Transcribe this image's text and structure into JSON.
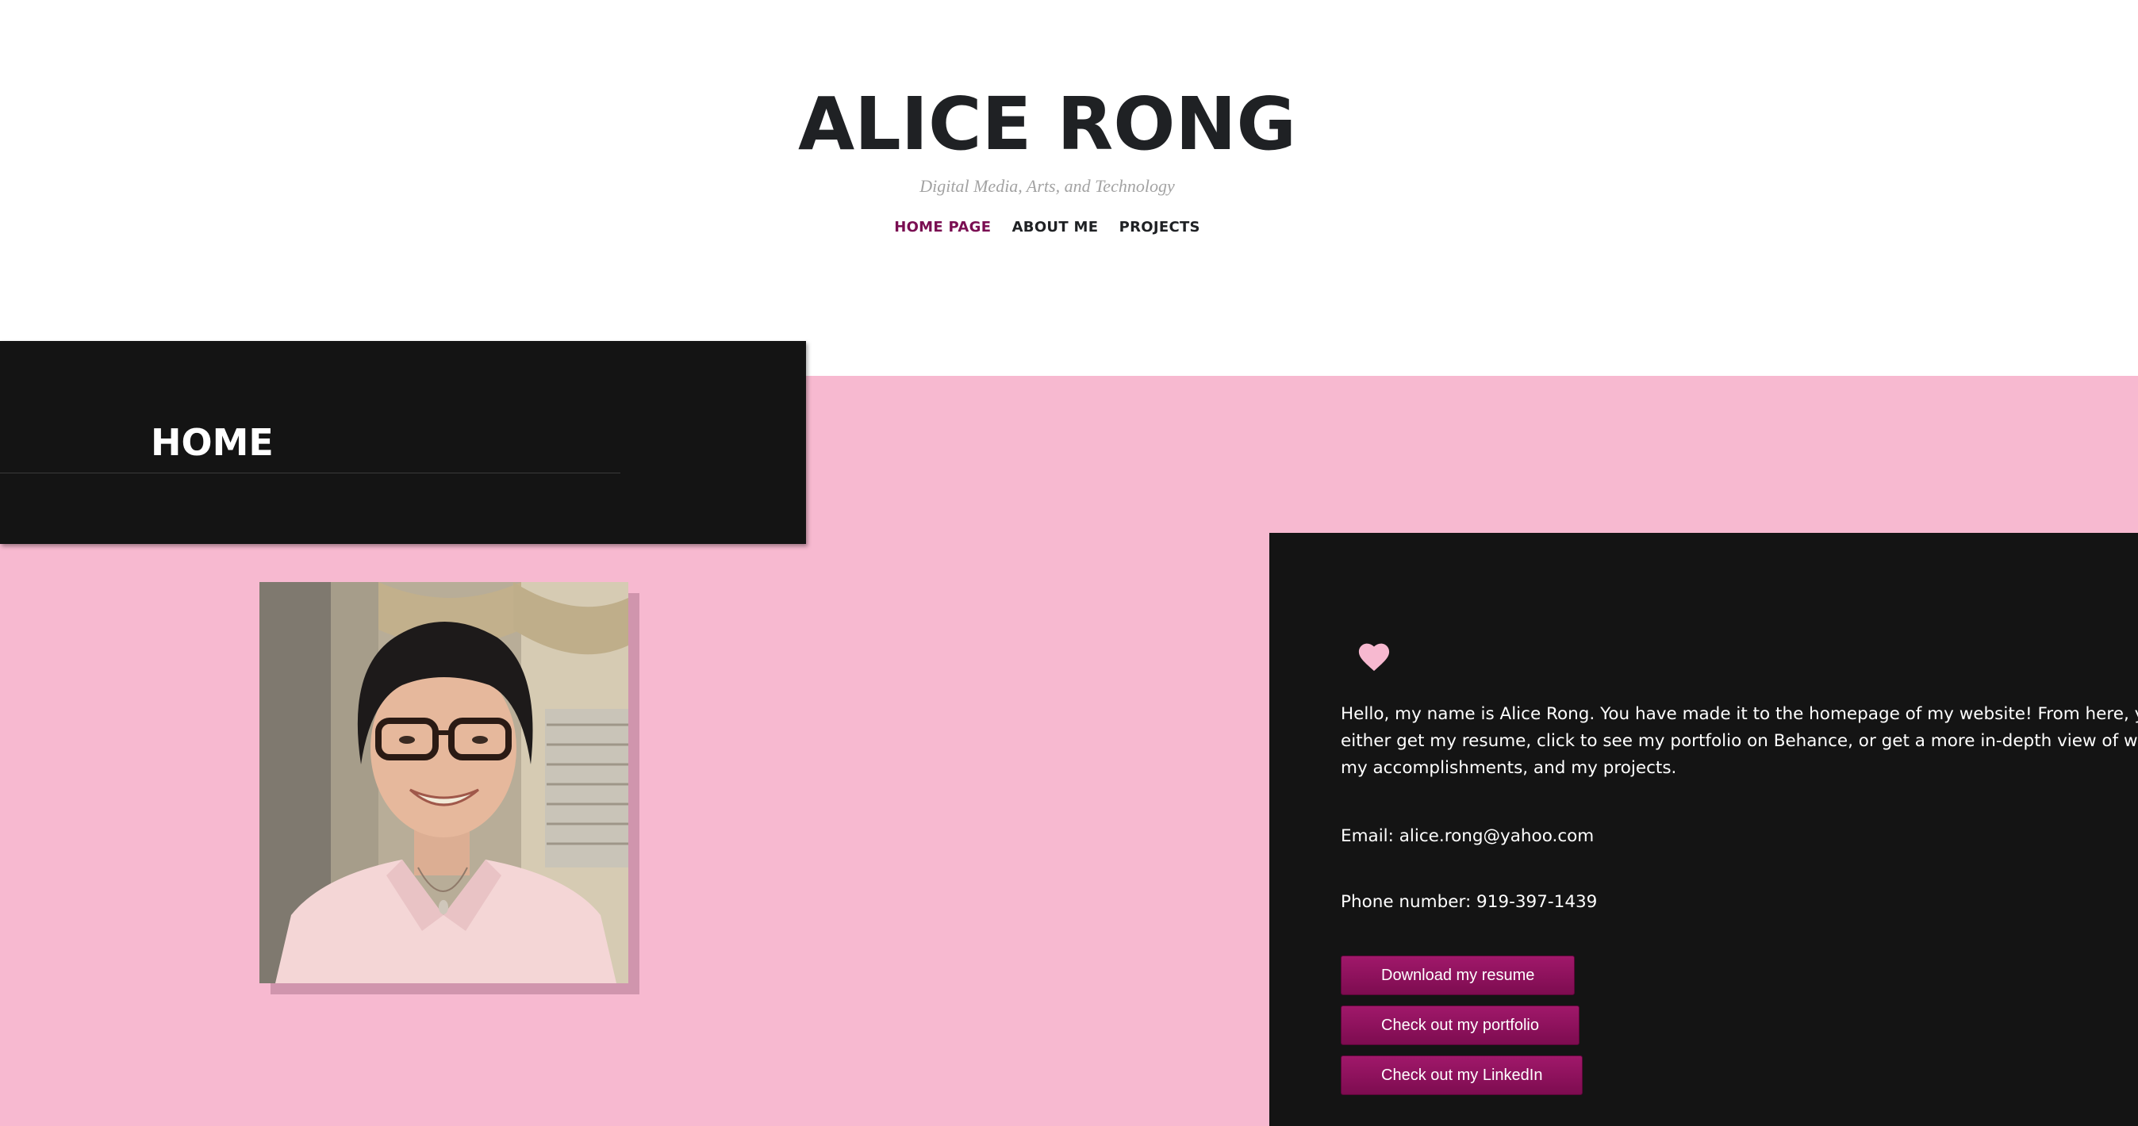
{
  "header": {
    "title": "ALICE RONG",
    "tagline": "Digital Media, Arts, and Technology",
    "nav": {
      "home": "HOME PAGE",
      "about": "ABOUT ME",
      "projects": "PROJECTS"
    }
  },
  "home_panel": {
    "title": "HOME"
  },
  "info_card": {
    "intro": "Hello, my name is Alice Rong. You have made it to the homepage of my website! From here, you can either get my resume, click to see my portfolio on Behance, or get a more in-depth view of who I am, my accomplishments, and my projects.",
    "email": "Email: alice.rong@yahoo.com",
    "phone": "Phone number: 919-397-1439",
    "buttons": {
      "resume": "Download my resume",
      "portfolio": "Check out my portfolio",
      "linkedin": "Check out my LinkedIn"
    }
  },
  "colors": {
    "accent": "#7a0e52",
    "pink_background": "#f7b9d0",
    "dark_panel": "#141414",
    "heart": "#f7b9d0"
  },
  "icons": {
    "heart": "heart-icon"
  }
}
